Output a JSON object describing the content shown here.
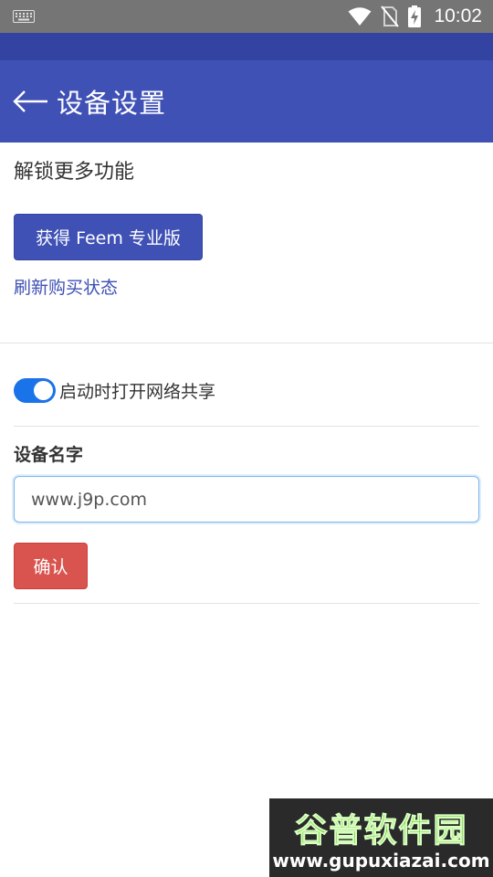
{
  "status_bar": {
    "time": "10:02",
    "icons": [
      "keyboard-icon",
      "wifi-icon",
      "no-sim-icon",
      "battery-charging-icon"
    ]
  },
  "app_bar": {
    "title": "设备设置",
    "back_icon": "arrow-left-icon"
  },
  "unlock_section": {
    "heading": "解锁更多功能",
    "pro_button_label": "获得 Feem 专业版",
    "refresh_link": "刷新购买状态"
  },
  "startup_share": {
    "label": "启动时打开网络共享",
    "enabled": true
  },
  "device_name": {
    "label": "设备名字",
    "value": "www.j9p.com",
    "confirm_label": "确认"
  },
  "watermark": {
    "title": "谷普软件园",
    "url": "www.gupuxiazai.com"
  },
  "colors": {
    "status_bar": "#757575",
    "app_bar_dark": "#3343a2",
    "app_bar": "#3f51b5",
    "primary_button": "#3f51b5",
    "link": "#3f51b5",
    "toggle_on": "#1a73e8",
    "danger_button": "#d9534f"
  }
}
